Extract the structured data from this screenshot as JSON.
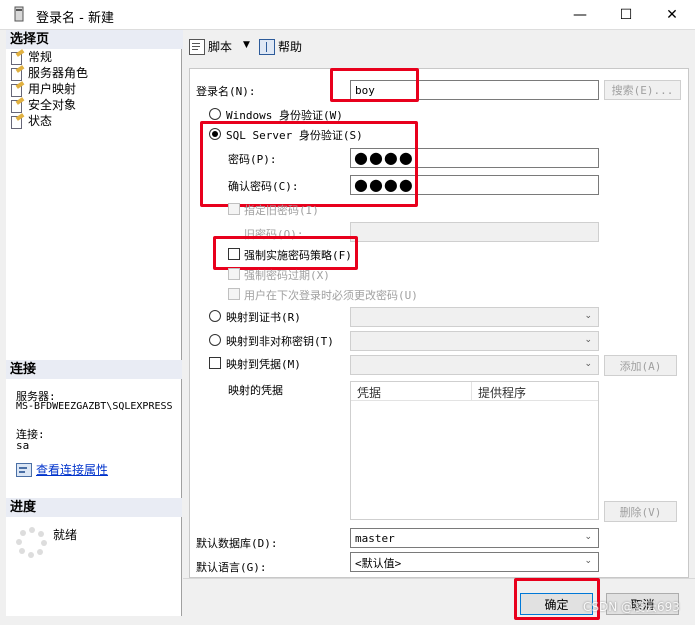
{
  "window": {
    "title": "登录名 - 新建",
    "minimize": "—",
    "maximize": "☐",
    "close": "✕"
  },
  "sidebar": {
    "header": "选择页",
    "items": [
      {
        "label": "常规"
      },
      {
        "label": "服务器角色"
      },
      {
        "label": "用户映射"
      },
      {
        "label": "安全对象"
      },
      {
        "label": "状态"
      }
    ],
    "connection_header": "连接",
    "server_label": "服务器:",
    "server_value": "MS-BFDWEEZGAZBT\\SQLEXPRESS",
    "connection_label": "连接:",
    "connection_value": "sa",
    "view_props_link": "查看连接属性",
    "progress_header": "进度",
    "progress_status": "就绪"
  },
  "toolbar": {
    "script_label": "脚本",
    "help_label": "帮助"
  },
  "form": {
    "login_name_label": "登录名(N):",
    "login_name_value": "boy",
    "search_button": "搜索(E)...",
    "windows_auth_label": "Windows 身份验证(W)",
    "sql_auth_label": "SQL Server 身份验证(S)",
    "password_label": "密码(P):",
    "password_value": "●●●●",
    "confirm_password_label": "确认密码(C):",
    "confirm_password_value": "●●●●",
    "specify_old_password_label": "指定旧密码(I)",
    "old_password_label": "旧密码(O):",
    "enforce_policy_label": "强制实施密码策略(F)",
    "enforce_expiration_label": "强制密码过期(X)",
    "must_change_label": "用户在下次登录时必须更改密码(U)",
    "map_cert_label": "映射到证书(R)",
    "map_asym_key_label": "映射到非对称密钥(T)",
    "map_credential_label": "映射到凭据(M)",
    "add_button": "添加(A)",
    "mapped_credentials_label": "映射的凭据",
    "credential_columns": [
      "凭据",
      "提供程序"
    ],
    "remove_button": "删除(V)",
    "default_db_label": "默认数据库(D):",
    "default_db_value": "master",
    "default_lang_label": "默认语言(G):",
    "default_lang_value": "<默认值>"
  },
  "footer": {
    "ok_button": "确定",
    "cancel_button": "取消",
    "watermark": "CSDN @凌云693"
  },
  "colors": {
    "highlight_red": "#e8001c",
    "link_blue": "#0033cc",
    "sidebar_header_bg": "#e9ecf4"
  }
}
